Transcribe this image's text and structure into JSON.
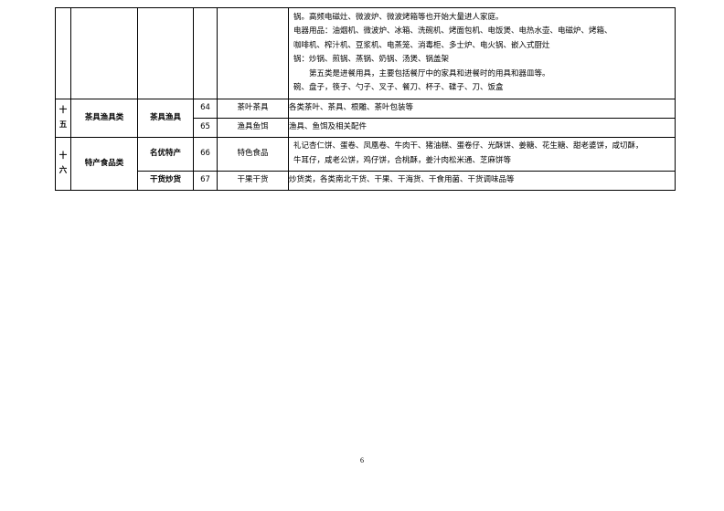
{
  "document": {
    "page_number": "6"
  },
  "table": {
    "rows": [
      {
        "id": "row-continued",
        "category_number": "",
        "category_name": "",
        "subcategory": "",
        "index": "",
        "item": "",
        "description_lines": [
          "锅。高频电磁灶、微波炉、微波烤箱等也开始大量进人家庭。",
          "电器用品：油烟机、微波炉、冰箱、洗碗机、烤面包机、电饭煲、电热水壶、电磁炉、烤箱、",
          "咖啡机、榨汁机、豆浆机、电蒸笼、消毒柜、多士炉、电火锅、嵌入式厨灶",
          "锅：炒锅、煎锅、蒸锅、奶锅、汤煲、锅盖架",
          "第五类是进餐用具，主要包括餐厅中的家具和进餐时的用具和器皿等。",
          "碗、盘子，筷子、勺子、叉子、餐刀、杯子、碟子、刀、饭盒"
        ],
        "indent_line_index": 4
      },
      {
        "id": "row-64",
        "category_number": "十五",
        "category_name": "茶具渔具类",
        "subcategory": "茶具渔具",
        "index": "64",
        "item": "茶叶茶具",
        "description_lines": [
          "各类茶叶、茶具、根雕、茶叶包装等"
        ]
      },
      {
        "id": "row-65",
        "category_number": "",
        "category_name": "",
        "subcategory": "",
        "index": "65",
        "item": "渔具鱼饵",
        "description_lines": [
          "渔具、鱼饵及相关配件"
        ]
      },
      {
        "id": "row-66",
        "category_number": "十六",
        "category_name": "特产食品类",
        "subcategory": "名优特产",
        "index": "66",
        "item": "特色食品",
        "description_lines": [
          "礼记杏仁饼、蛋卷、凤凰卷、牛肉干、猪油糕、蛋卷仔、光酥饼、姜糖、花生糖、甜老婆饼，咸切酥，",
          "牛耳仔，咸老公饼，鸡仔饼，合桃酥，姜汁肉松米通、芝麻饼等"
        ]
      },
      {
        "id": "row-67",
        "category_number": "",
        "category_name": "",
        "subcategory": "干货炒货",
        "index": "67",
        "item": "干果干货",
        "description_lines": [
          "炒货类，各类南北干货、干果、干海货、干食用菌、干货调味品等"
        ]
      }
    ]
  }
}
